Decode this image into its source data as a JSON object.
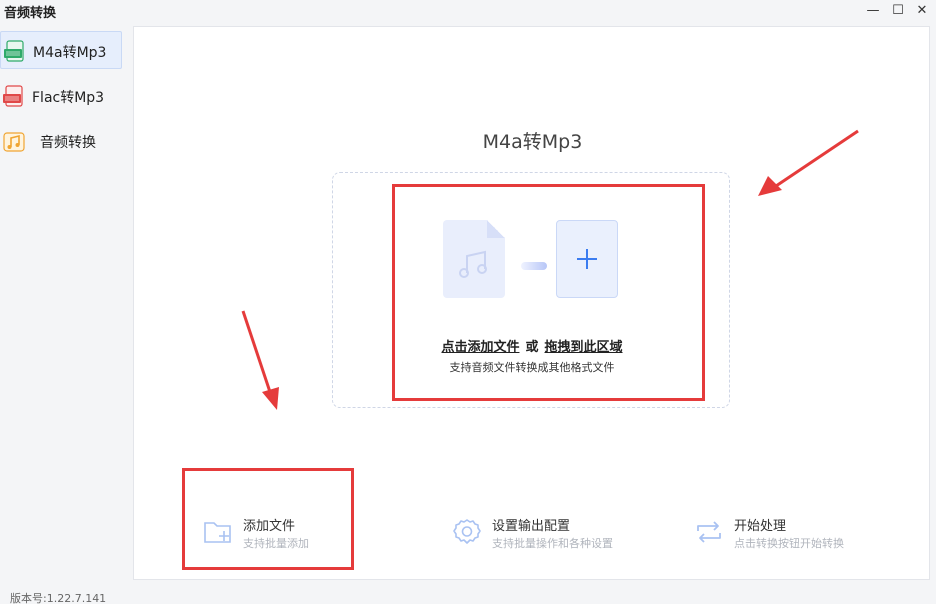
{
  "window": {
    "title": "音频转换",
    "minimize": "—",
    "maximize": "☐",
    "close": "✕"
  },
  "sidebar": {
    "items": [
      {
        "label": "M4a转Mp3",
        "icon": "m4a-file-icon",
        "active": true
      },
      {
        "label": "Flac转Mp3",
        "icon": "flac-file-icon",
        "active": false
      },
      {
        "label": "音频转换",
        "icon": "music-note-icon",
        "active": false
      }
    ]
  },
  "main": {
    "title": "M4a转Mp3",
    "drop_zone": {
      "link_add": "点击添加文件",
      "or": "或",
      "link_drag": "拖拽到此区域",
      "subtitle": "支持音频文件转换成其他格式文件"
    },
    "actions": [
      {
        "title": "添加文件",
        "subtitle": "支持批量添加",
        "icon": "folder-add-icon"
      },
      {
        "title": "设置输出配置",
        "subtitle": "支持批量操作和各种设置",
        "icon": "gear-icon"
      },
      {
        "title": "开始处理",
        "subtitle": "点击转换按钮开始转换",
        "icon": "convert-arrows-icon"
      }
    ]
  },
  "footer": {
    "version": "版本号:1.22.7.141"
  },
  "colors": {
    "accent": "#3b7cf0",
    "annotation_red": "#e53b3b",
    "m4a_icon": "#2faa6a",
    "flac_icon": "#e04848",
    "music_icon": "#f0a532"
  }
}
